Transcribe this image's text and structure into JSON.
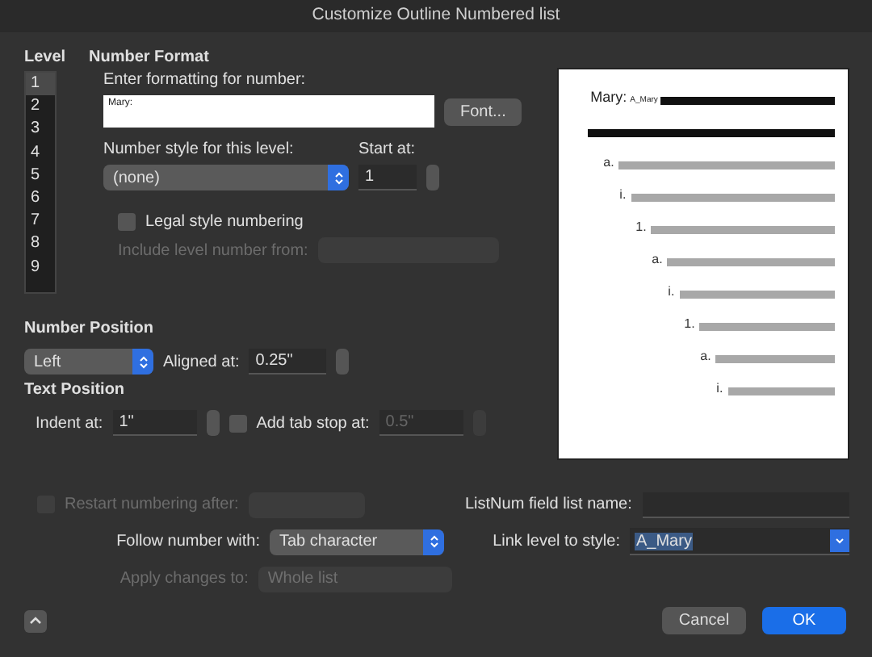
{
  "window": {
    "title": "Customize Outline Numbered list"
  },
  "level": {
    "heading": "Level",
    "items": [
      {
        "label": "1",
        "selected": true
      },
      {
        "label": "2",
        "selected": false
      },
      {
        "label": "3",
        "selected": false
      },
      {
        "label": "4",
        "selected": false
      },
      {
        "label": "5",
        "selected": false
      },
      {
        "label": "6",
        "selected": false
      },
      {
        "label": "7",
        "selected": false
      },
      {
        "label": "8",
        "selected": false
      },
      {
        "label": "9",
        "selected": false
      }
    ]
  },
  "number_format": {
    "heading": "Number Format",
    "format_label": "Enter formatting for number:",
    "format_value": "Mary:",
    "font_button": "Font...",
    "style_label": "Number style for this level:",
    "style_value": "(none)",
    "start_label": "Start at:",
    "start_value": "1",
    "legal": {
      "label": "Legal style numbering",
      "checked": false
    },
    "include_label": "Include level number from:",
    "include_disabled": true
  },
  "preview": {
    "first_label": "Mary:",
    "first_style": "A_Mary",
    "lines": [
      {
        "label": "a."
      },
      {
        "label": "i."
      },
      {
        "label": "1."
      },
      {
        "label": "a."
      },
      {
        "label": "i."
      },
      {
        "label": "1."
      },
      {
        "label": "a."
      },
      {
        "label": "i."
      }
    ]
  },
  "number_position": {
    "heading": "Number Position",
    "alignment": "Left",
    "aligned_label": "Aligned at:",
    "aligned_value": "0.25\""
  },
  "text_position": {
    "heading": "Text Position",
    "indent_label": "Indent at:",
    "indent_value": "1\"",
    "tab_stop": {
      "label": "Add tab stop at:",
      "checked": false
    },
    "tab_value": "0.5\"",
    "tab_disabled": true
  },
  "restart": {
    "label": "Restart numbering after:",
    "checked": false,
    "disabled": true
  },
  "listnum_label": "ListNum field list name:",
  "follow": {
    "label": "Follow number with:",
    "value": "Tab character"
  },
  "link": {
    "label": "Link level to style:",
    "value": "A_Mary"
  },
  "apply": {
    "label": "Apply changes to:",
    "value": "Whole list",
    "disabled": true
  },
  "buttons": {
    "cancel": "Cancel",
    "ok": "OK"
  }
}
